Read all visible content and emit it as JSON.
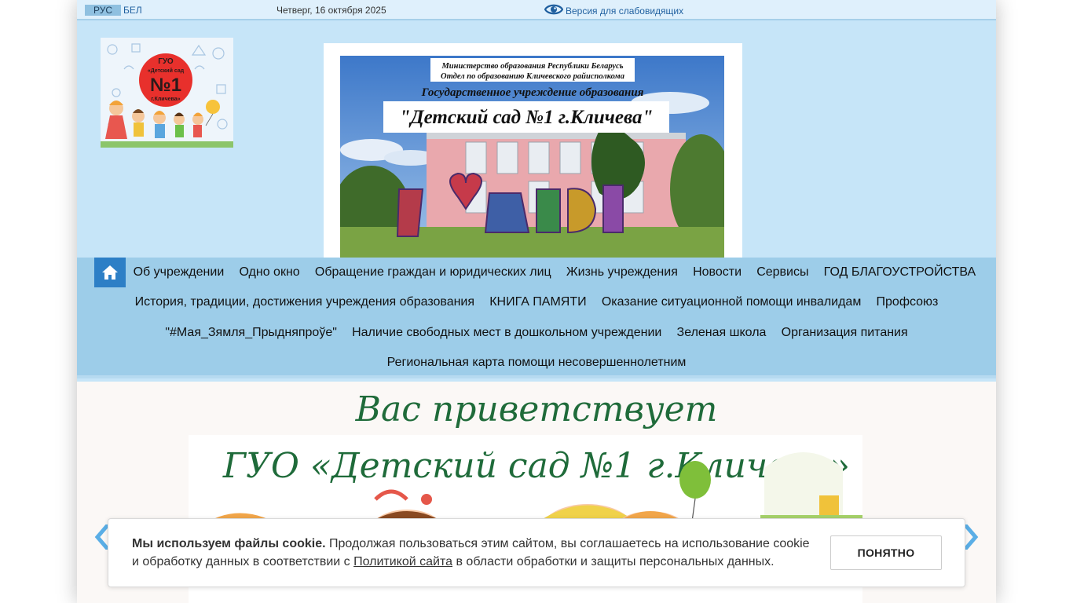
{
  "topbar": {
    "lang_ru": "РУС",
    "lang_by": "БЕЛ",
    "date": "Четверг, 16 октября 2025",
    "vision_link": "Версия для слабовидящих"
  },
  "logo": {
    "line1": "ГУО",
    "line2": "«Детский сад",
    "line3": "№1",
    "line4": "г.Кличева»"
  },
  "banner": {
    "ministry_line1": "Министерство образования Республики Беларусь",
    "ministry_line2": "Отдел по образованию Кличевского райисполкома",
    "institution_type": "Государственное учреждение образования",
    "name": "\"Детский сад №1 г.Кличева\"",
    "sculpture_text": "Я♥ДС1"
  },
  "nav": {
    "home_icon": "home-icon",
    "row1": [
      "Об учреждении",
      "Одно окно",
      "Обращение граждан и юридических лиц",
      "Жизнь учреждения",
      "Новости",
      "Сервисы",
      "ГОД БЛАГОУСТРОЙСТВА"
    ],
    "row2": [
      "История, традиции, достижения учреждения образования",
      "КНИГА ПАМЯТИ",
      "Оказание ситуационной помощи инвалидам",
      "Профсоюз"
    ],
    "row3": [
      "\"#Мая_Зямля_Прыдняпроўе\"",
      "Наличие свободных мест в дошкольном учреждении",
      "Зеленая школа",
      "Организация питания"
    ],
    "row4": [
      "Региональная карта помощи несовершеннолетним"
    ]
  },
  "slider": {
    "greeting": "Вас приветствует",
    "title": "ГУО «Детский сад №1 г.Кличева»"
  },
  "cookie": {
    "bold": "Мы используем файлы cookie.",
    "text1": " Продолжая пользоваться этим сайтом, вы соглашаетесь на использование cookie и обработку данных в соответствии с ",
    "link": "Политикой сайта",
    "text2": " в области обработки и защиты персональных данных.",
    "button": "ПОНЯТНО"
  },
  "colors": {
    "header_bg": "#c6e5f8",
    "nav_bg": "#9dcde9",
    "home_button": "#2d7fc6",
    "link": "#1f5f9f"
  }
}
